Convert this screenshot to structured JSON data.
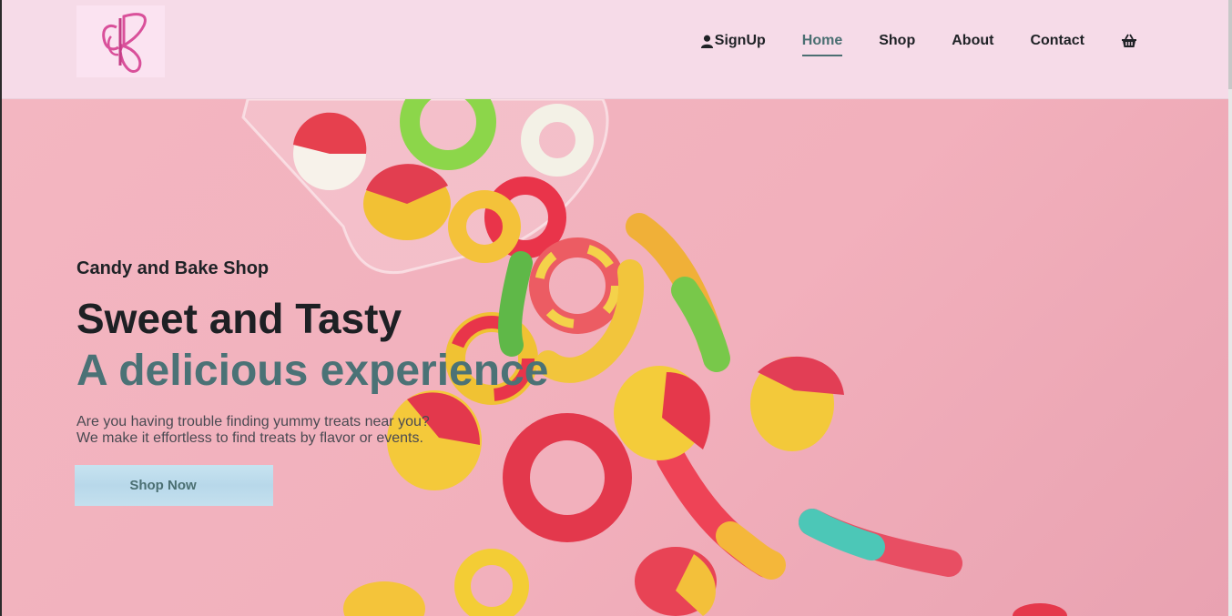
{
  "header": {
    "logo": {
      "icon": "butterfly-icon"
    },
    "nav": [
      {
        "label": "SignUp",
        "icon": "user-icon",
        "active": false
      },
      {
        "label": "Home",
        "active": true
      },
      {
        "label": "Shop",
        "active": false
      },
      {
        "label": "About",
        "active": false
      },
      {
        "label": "Contact",
        "active": false
      }
    ],
    "cart": {
      "icon": "basket-icon"
    }
  },
  "hero": {
    "kicker": "Candy and Bake Shop",
    "title": "Sweet and Tasty",
    "subtitle": "A delicious experience",
    "description_line1": "Are you having trouble finding yummy treats near you?",
    "description_line2": "We make it effortless to find treats by flavor or events.",
    "cta": "Shop Now"
  },
  "colors": {
    "header_bg": "#f6dbe8",
    "hero_bg": "#f3b6c1",
    "accent": "#4b7276",
    "button_bg": "#c7e3f0"
  }
}
